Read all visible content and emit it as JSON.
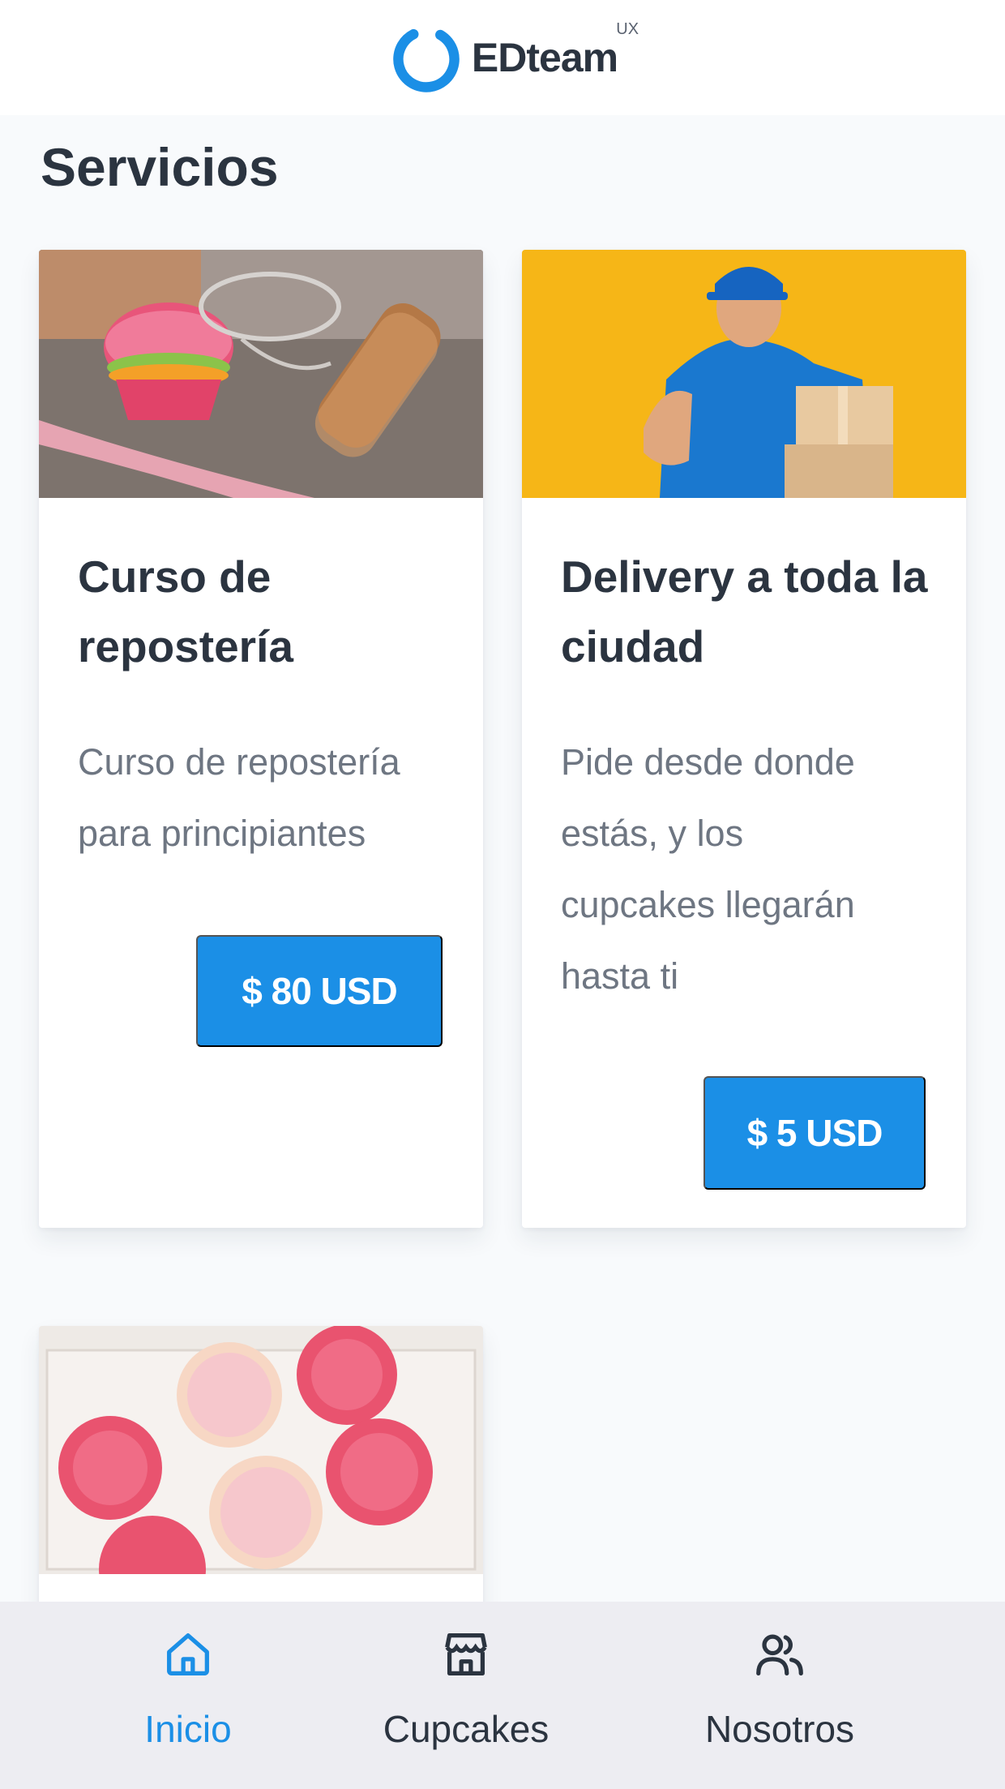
{
  "header": {
    "logo_text": "EDteam",
    "logo_sup": "UX",
    "brand_color": "#1b8fe6"
  },
  "section": {
    "title": "Servicios"
  },
  "cards": [
    {
      "title": "Curso de repostería",
      "description": "Curso de repostería para principiantes",
      "price": "$ 80 USD",
      "image": "baking-tools-photo"
    },
    {
      "title": "Delivery a toda la ciudad",
      "description": "Pide desde donde estás, y los cupcakes llegarán hasta ti",
      "price": "$ 5 USD",
      "image": "delivery-man-photo"
    },
    {
      "image": "pink-cupcakes-box-photo"
    }
  ],
  "bottom_nav": {
    "items": [
      {
        "label": "Inicio",
        "icon": "home-icon",
        "active": true
      },
      {
        "label": "Cupcakes",
        "icon": "store-icon",
        "active": false
      },
      {
        "label": "Nosotros",
        "icon": "users-icon",
        "active": false
      }
    ],
    "active_color": "#1b8fe6"
  }
}
